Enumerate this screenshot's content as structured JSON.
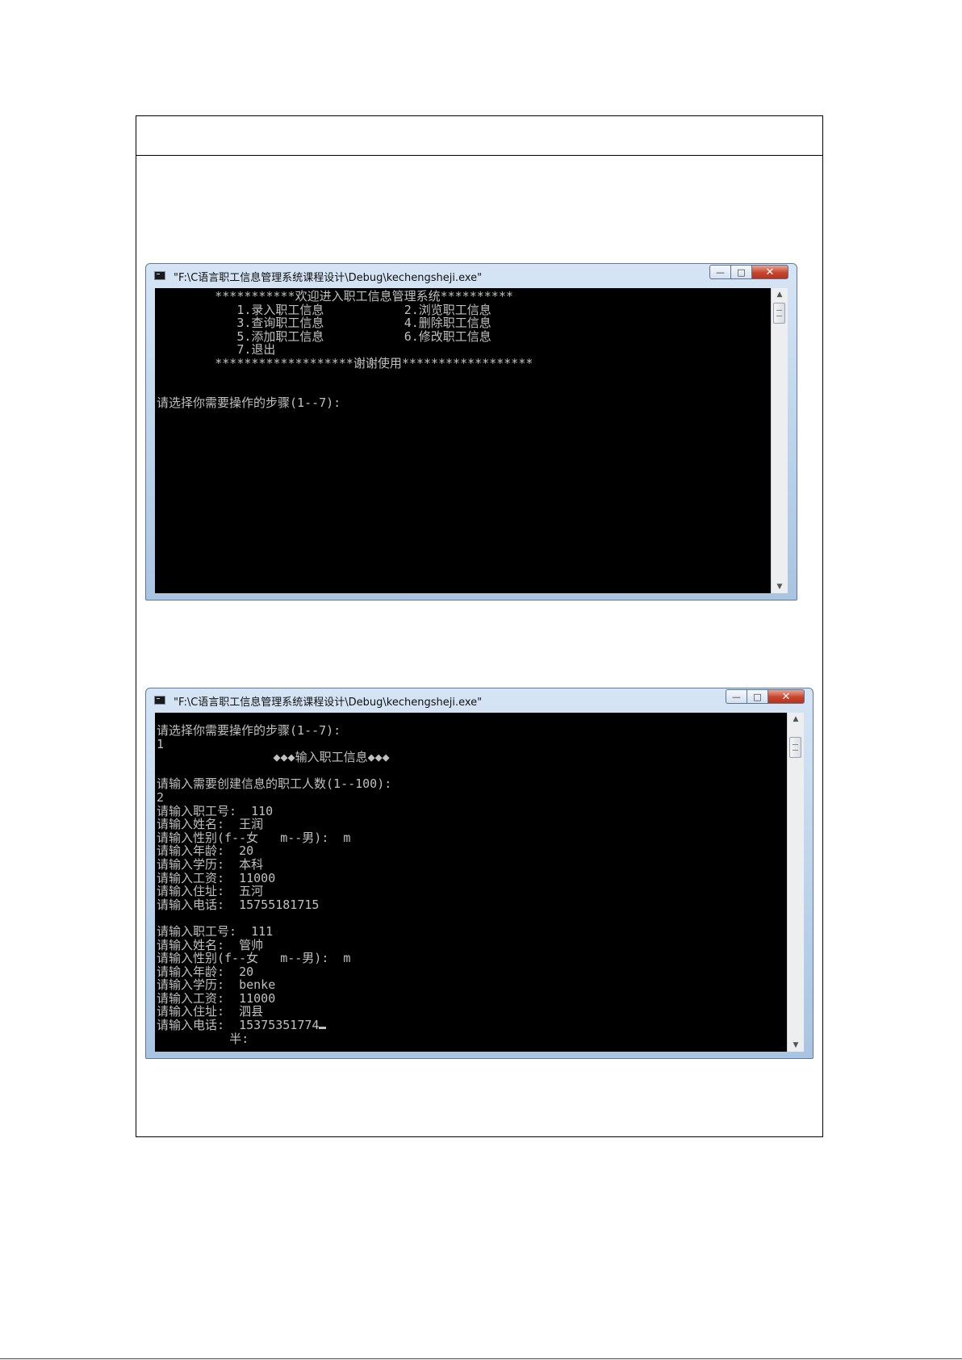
{
  "window1": {
    "title": "\"F:\\C语言职工信息管理系统课程设计\\Debug\\kechengsheji.exe\"",
    "lines": [
      "        ***********欢迎进入职工信息管理系统**********",
      "           1.录入职工信息           2.浏览职工信息",
      "           3.查询职工信息           4.删除职工信息",
      "           5.添加职工信息           6.修改职工信息",
      "           7.退出",
      "        *******************谢谢使用******************",
      "",
      "",
      "请选择你需要操作的步骤(1--7):"
    ]
  },
  "window2": {
    "title": "\"F:\\C语言职工信息管理系统课程设计\\Debug\\kechengsheji.exe\"",
    "lines": [
      "请选择你需要操作的步骤(1--7):",
      "1",
      "                ◆◆◆输入职工信息◆◆◆",
      "",
      "请输入需要创建信息的职工人数(1--100):",
      "2",
      "请输入职工号:  110",
      "请输入姓名:  王润",
      "请输入性别(f--女   m--男):  m",
      "请输入年龄:  20",
      "请输入学历:  本科",
      "请输入工资:  11000",
      "请输入住址:  五河",
      "请输入电话:  15755181715",
      "",
      "请输入职工号:  111",
      "请输入姓名:  管帅",
      "请输入性别(f--女   m--男):  m",
      "请输入年龄:  20",
      "请输入学历:  benke",
      "请输入工资:  11000",
      "请输入住址:  泗县"
    ],
    "last_line": "请输入电话:  15375351774",
    "ime_line": "          半:"
  },
  "caption_buttons": {
    "minimize": "—",
    "maximize": "□",
    "close": "✕"
  }
}
